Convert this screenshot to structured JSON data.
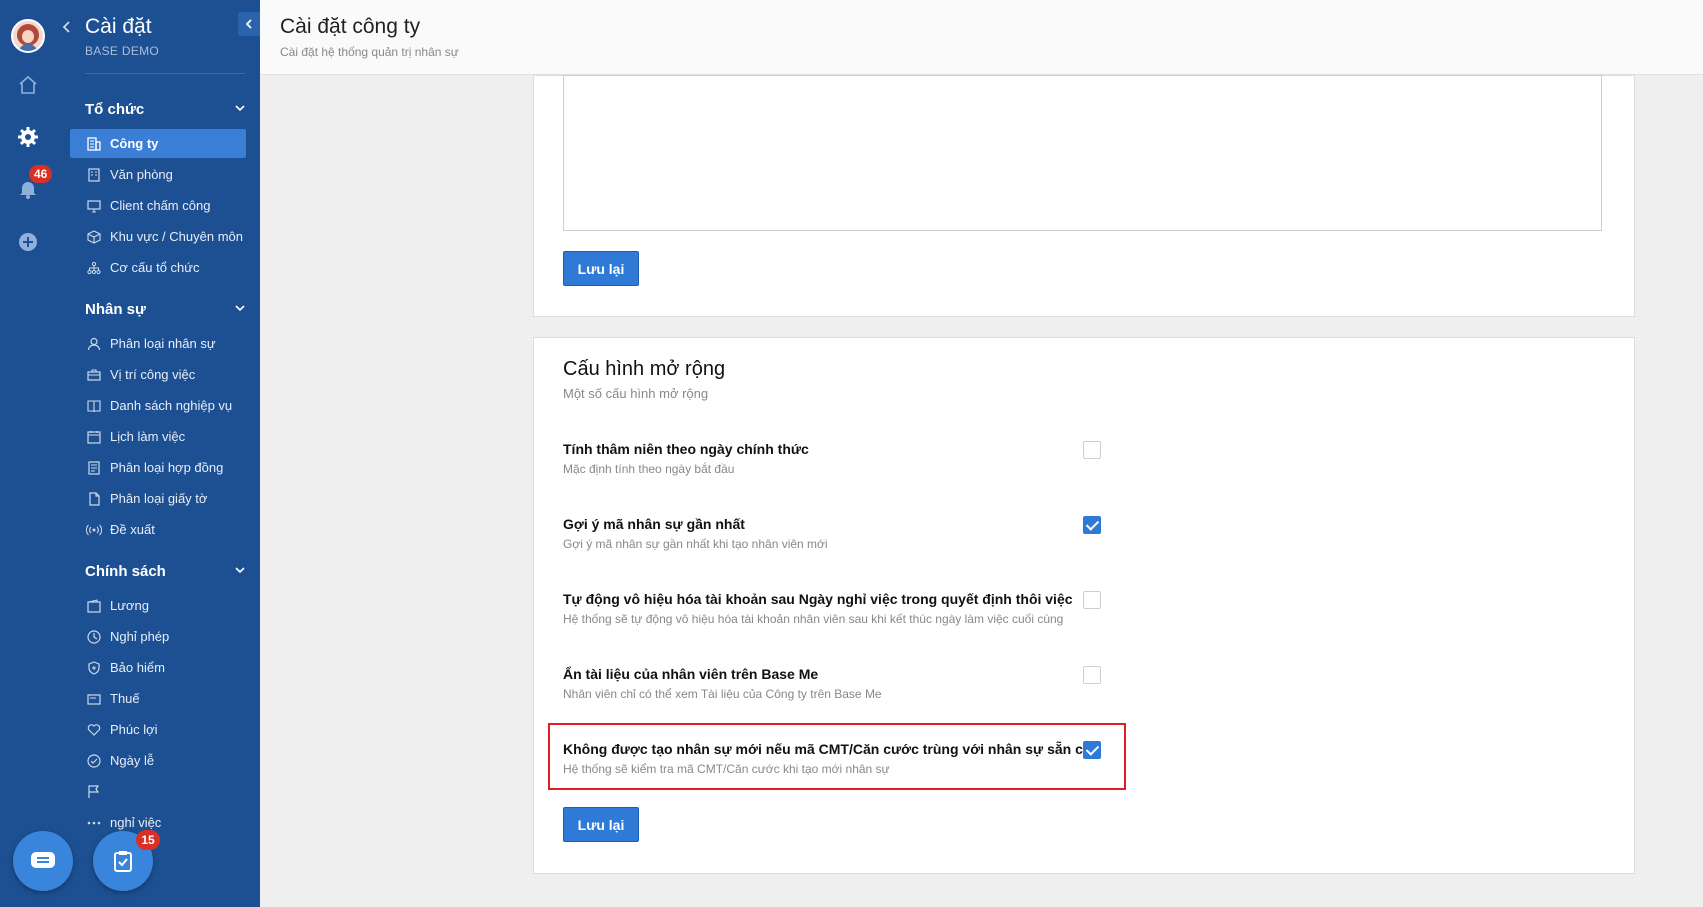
{
  "rail": {
    "notification_count": "46"
  },
  "sidebar": {
    "title": "Cài đặt",
    "subtitle": "BASE DEMO",
    "sections": [
      {
        "label": "Tổ chức",
        "items": [
          {
            "label": "Công ty",
            "icon": "building-icon",
            "active": true
          },
          {
            "label": "Văn phòng",
            "icon": "office-icon"
          },
          {
            "label": "Client chấm công",
            "icon": "monitor-icon"
          },
          {
            "label": "Khu vực / Chuyên môn",
            "icon": "cube-icon"
          },
          {
            "label": "Cơ cấu tổ chức",
            "icon": "org-chart-icon"
          }
        ]
      },
      {
        "label": "Nhân sự",
        "items": [
          {
            "label": "Phân loại nhân sự",
            "icon": "user-icon"
          },
          {
            "label": "Vị trí công việc",
            "icon": "briefcase-icon"
          },
          {
            "label": "Danh sách nghiệp vụ",
            "icon": "book-icon"
          },
          {
            "label": "Lịch làm việc",
            "icon": "calendar-icon"
          },
          {
            "label": "Phân loại hợp đồng",
            "icon": "contract-icon"
          },
          {
            "label": "Phân loại giấy tờ",
            "icon": "document-icon"
          },
          {
            "label": "Đề xuất",
            "icon": "broadcast-icon"
          }
        ]
      },
      {
        "label": "Chính sách",
        "items": [
          {
            "label": "Lương",
            "icon": "wallet-icon"
          },
          {
            "label": "Nghỉ phép",
            "icon": "clock-icon"
          },
          {
            "label": "Bảo hiểm",
            "icon": "shield-icon"
          },
          {
            "label": "Thuế",
            "icon": "tax-icon"
          },
          {
            "label": "Phúc lợi",
            "icon": "heart-icon"
          },
          {
            "label": "Ngày lễ",
            "icon": "check-circle-icon"
          },
          {
            "label": "",
            "icon": "flag-icon"
          },
          {
            "label": "nghỉ việc",
            "icon": "dots-icon"
          }
        ]
      }
    ]
  },
  "fab": {
    "task_count": "15"
  },
  "header": {
    "title": "Cài đặt công ty",
    "subtitle": "Cài đặt hệ thống quản trị nhân sự"
  },
  "top_card": {
    "save_label": "Lưu lại"
  },
  "ext_card": {
    "title": "Cấu hình mở rộng",
    "subtitle": "Một số cấu hình mở rộng",
    "save_label": "Lưu lại",
    "options": [
      {
        "title": "Tính thâm niên theo ngày chính thức",
        "desc": "Mặc định tính theo ngày bắt đầu",
        "checked": false
      },
      {
        "title": "Gợi ý mã nhân sự gần nhất",
        "desc": "Gợi ý mã nhân sự gần nhất khi tạo nhân viên mới",
        "checked": true
      },
      {
        "title": "Tự động vô hiệu hóa tài khoản sau Ngày nghỉ việc trong quyết định thôi việc",
        "desc": "Hệ thống sẽ tự động vô hiệu hóa tài khoản nhân viên sau khi kết thúc ngày làm việc cuối cùng",
        "checked": false
      },
      {
        "title": "Ẩn tài liệu của nhân viên trên Base Me",
        "desc": "Nhân viên chỉ có thể xem Tài liệu của Công ty trên Base Me",
        "checked": false
      },
      {
        "title": "Không được tạo nhân sự mới nếu mã CMT/Căn cước trùng với nhân sự sẵn có",
        "desc": "Hệ thống sẽ kiểm tra mã CMT/Căn cước khi tạo mới nhân sự",
        "checked": true
      }
    ]
  },
  "colors": {
    "sidebar_bg": "#1d5092",
    "accent": "#2f7ad6",
    "highlight": "#e01e24",
    "badge": "#d93025"
  }
}
